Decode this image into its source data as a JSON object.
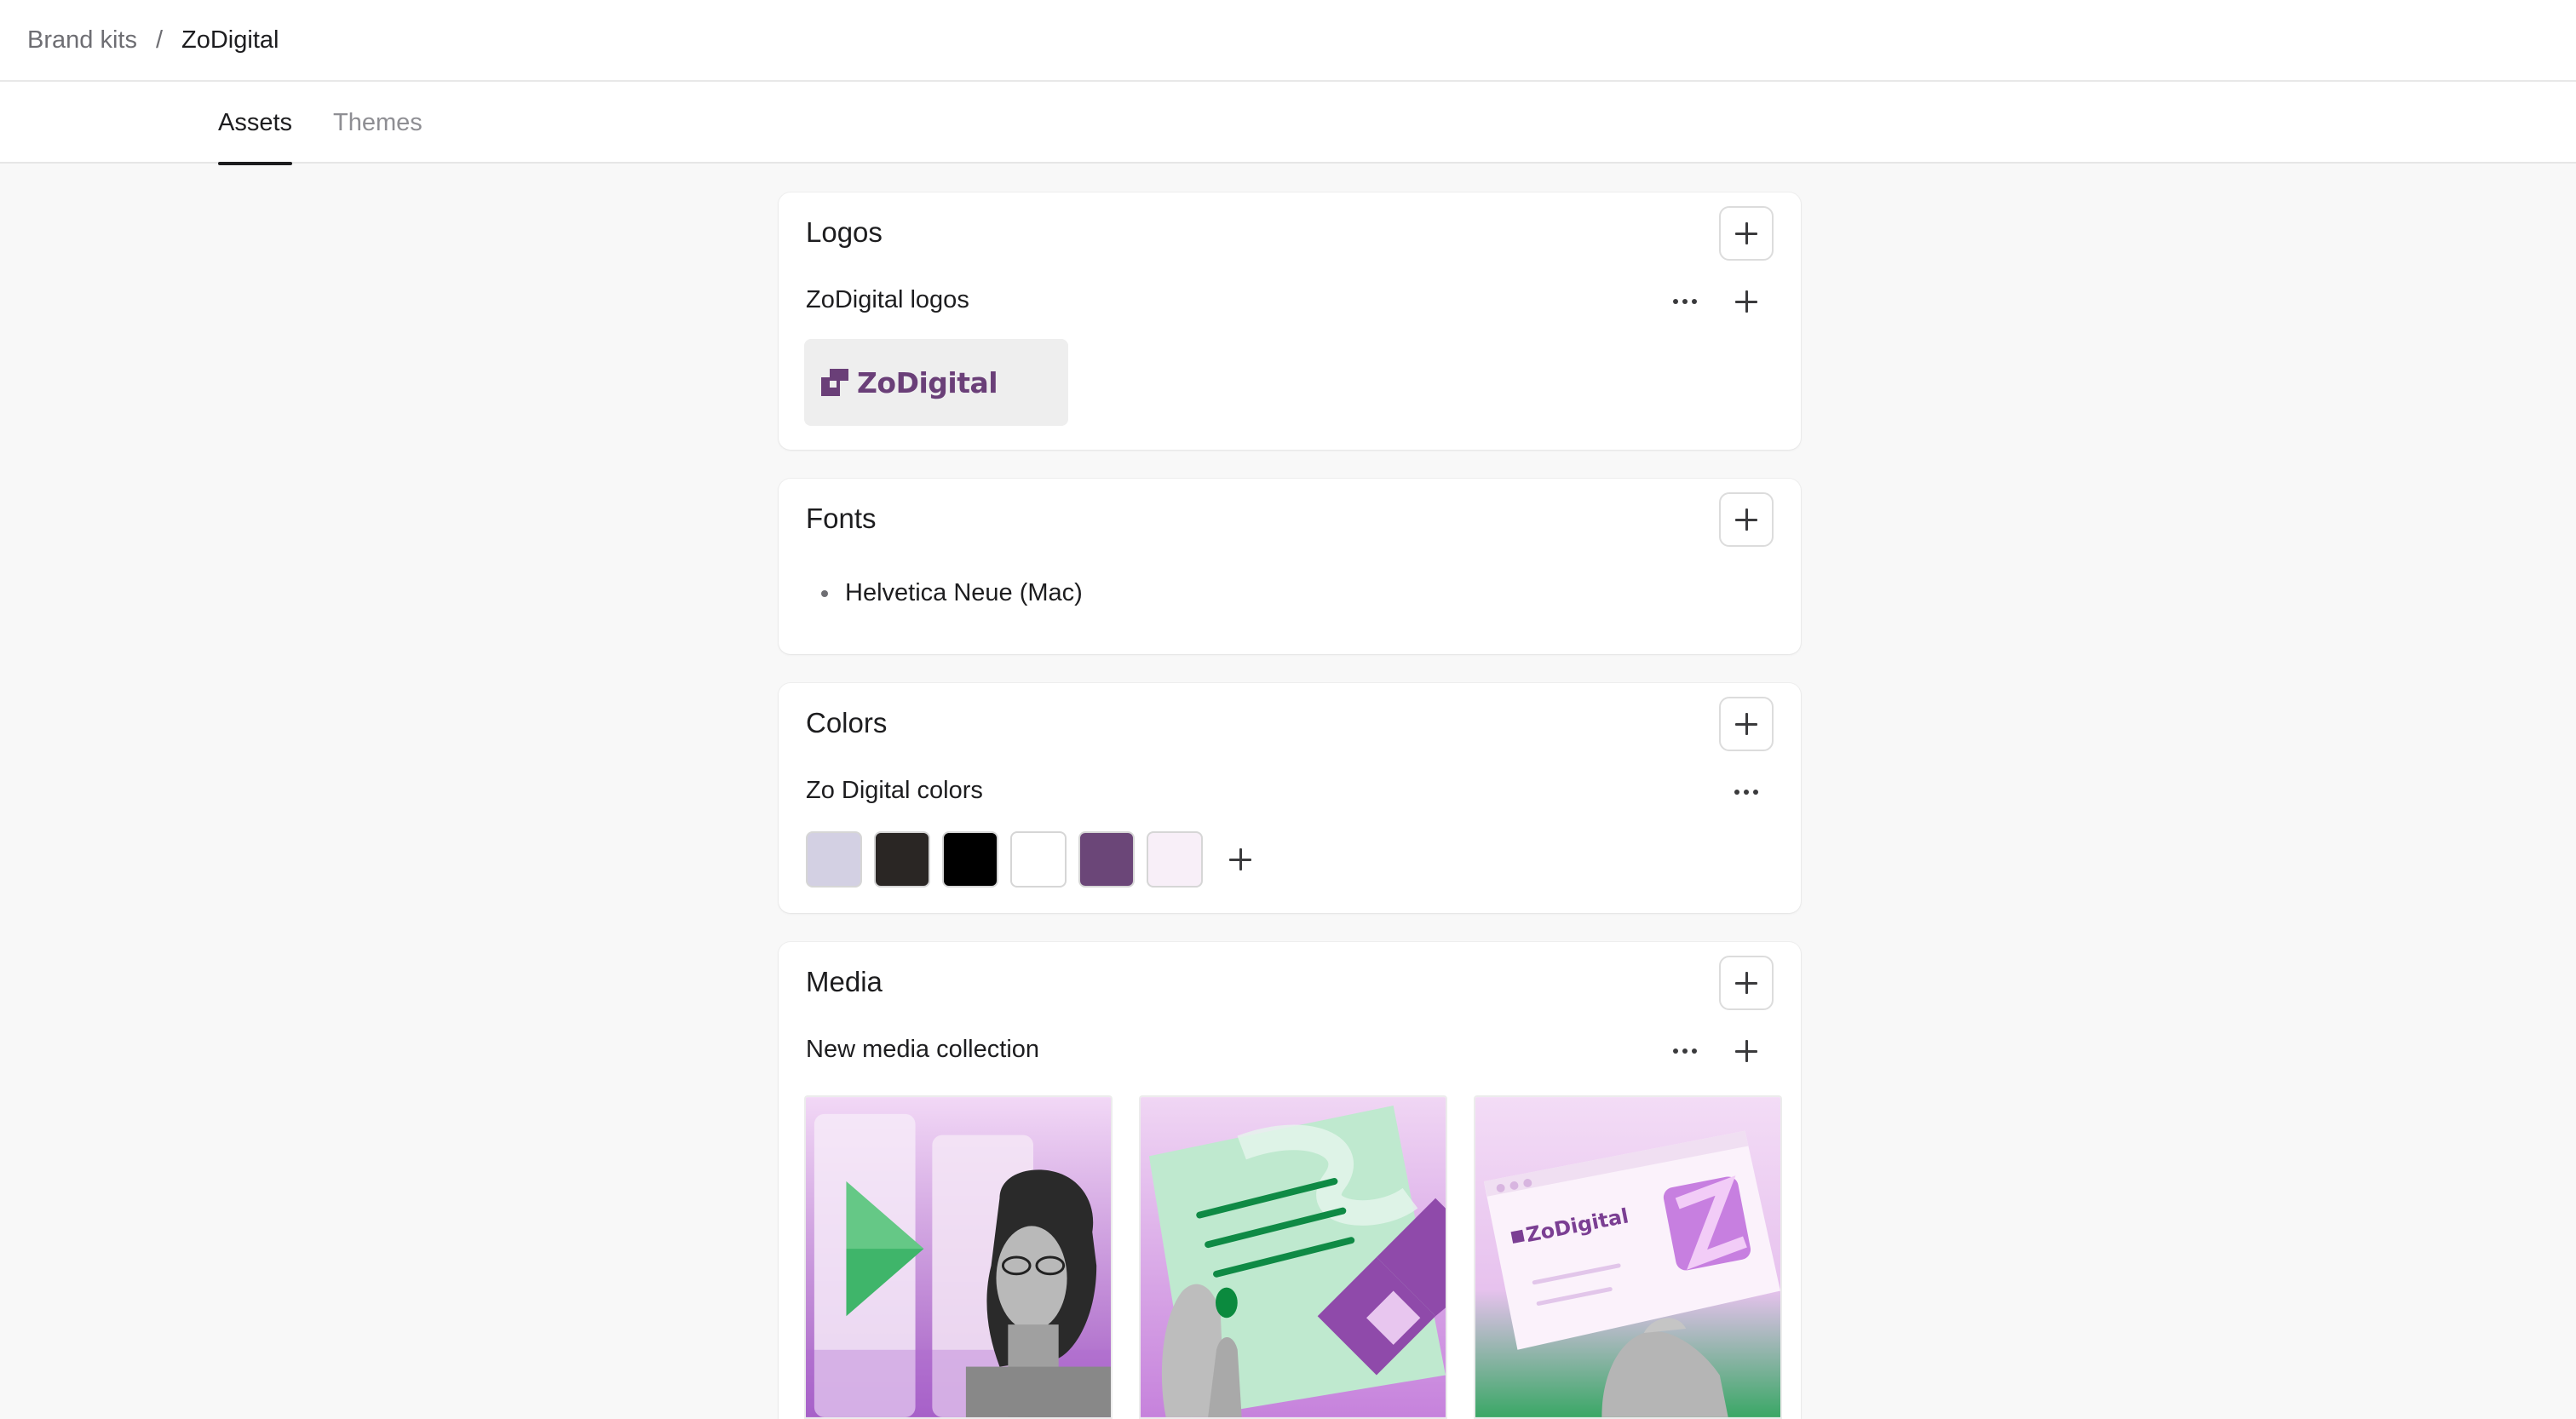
{
  "breadcrumb": {
    "parent": "Brand kits",
    "separator": "/",
    "current": "ZoDigital"
  },
  "tabs": [
    {
      "label": "Assets",
      "active": true
    },
    {
      "label": "Themes",
      "active": false
    }
  ],
  "logos": {
    "title": "Logos",
    "collection": "ZoDigital logos",
    "logo_text": "ZoDigital",
    "logo_color": "#6a3f78"
  },
  "fonts": {
    "title": "Fonts",
    "items": [
      "Helvetica Neue (Mac)"
    ]
  },
  "colors": {
    "title": "Colors",
    "palette_name": "Zo Digital colors",
    "swatches": [
      "#d3d0e3",
      "#2a2624",
      "#000000",
      "#ffffff",
      "#6b4678",
      "#f8eff8"
    ]
  },
  "media": {
    "title": "Media",
    "collection": "New media collection",
    "tiles": [
      {
        "icon": "play-portrait-image"
      },
      {
        "icon": "document-hand-image"
      },
      {
        "icon": "browser-card-image",
        "text": "ZoDigital"
      }
    ]
  },
  "icons": {
    "add": "plus-icon",
    "more": "more-icon"
  }
}
